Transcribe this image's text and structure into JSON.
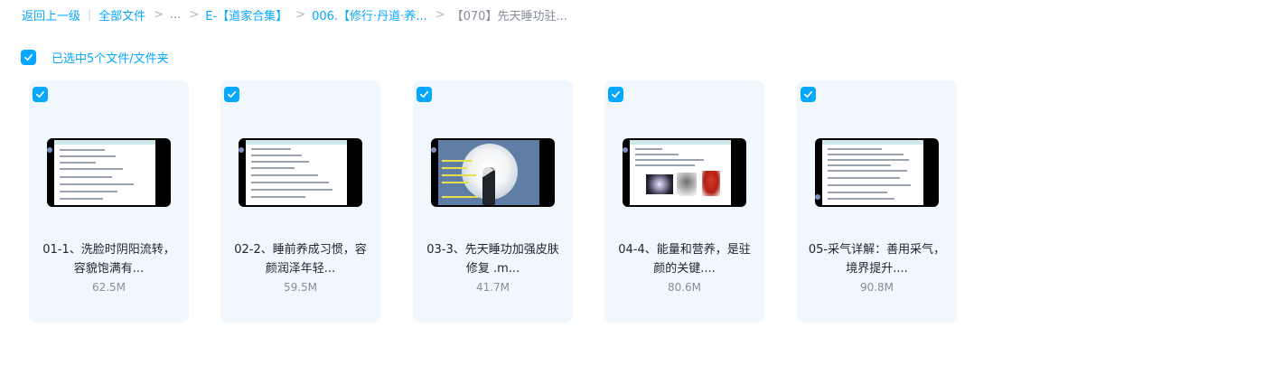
{
  "breadcrumb": {
    "back": "返回上一级",
    "separator": "|",
    "all_files": "全部文件",
    "arrow": ">",
    "ellipsis": "...",
    "folder1": "E-【道家合集】",
    "folder2": "006.【修行·丹道·养...",
    "current": "【070】先天睡功驻..."
  },
  "selection": {
    "label": "已选中5个文件/文件夹",
    "checked": true
  },
  "files": [
    {
      "title_line1": "01-1、洗脸时阴阳流转，",
      "title_line2": "容貌饱满有...",
      "size": "62.5M"
    },
    {
      "title_line1": "02-2、睡前养成习惯，容",
      "title_line2": "颜润泽年轻...",
      "size": "59.5M"
    },
    {
      "title_line1": "03-3、先天睡功加强皮肤",
      "title_line2": "修复 .m...",
      "size": "41.7M"
    },
    {
      "title_line1": "04-4、能量和营养，是驻",
      "title_line2": "颜的关键....",
      "size": "80.6M"
    },
    {
      "title_line1": "05-采气详解：善用采气，",
      "title_line2": "境界提升....",
      "size": "90.8M"
    }
  ],
  "colors": {
    "accent": "#06a7ff",
    "card_bg": "#f0f8fd",
    "muted": "#878c9c"
  },
  "icons": {
    "checkbox": "check-icon",
    "video": "video-thumbnail"
  }
}
